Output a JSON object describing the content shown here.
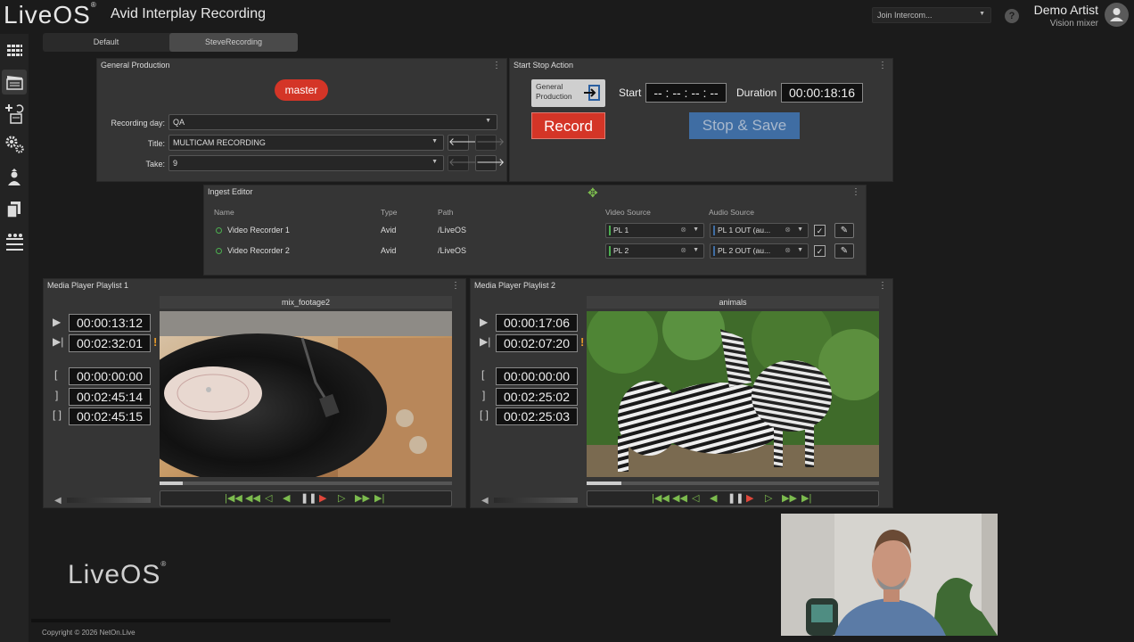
{
  "app": {
    "logo": "LiveOS",
    "title": "Avid Interplay Recording",
    "intercom_placeholder": "Join Intercom...",
    "help": "?",
    "user_name": "Demo Artist",
    "user_role": "Vision mixer"
  },
  "sidebar": [
    {
      "icon": "grid-icon"
    },
    {
      "icon": "clapper-icon"
    },
    {
      "icon": "add-clip-icon"
    },
    {
      "icon": "settings-gears-icon"
    },
    {
      "icon": "user-upload-icon"
    },
    {
      "icon": "copy-icon"
    },
    {
      "icon": "mixer-icon"
    }
  ],
  "tabs": [
    {
      "label": "Default",
      "active": false
    },
    {
      "label": "SteveRecording",
      "active": true
    }
  ],
  "general_production": {
    "title": "General Production",
    "badge": "master",
    "recording_day_label": "Recording day:",
    "recording_day_value": "QA",
    "title_label": "Title:",
    "title_value": "MULTICAM RECORDING",
    "take_label": "Take:",
    "take_value": "9"
  },
  "start_stop": {
    "title": "Start Stop Action",
    "source_label": "General Production",
    "start_label": "Start",
    "start_value": "-- : -- : -- : --",
    "duration_label": "Duration",
    "duration_value": "00:00:18:16",
    "record_label": "Record",
    "stop_label": "Stop & Save"
  },
  "ingest_editor": {
    "title": "Ingest Editor",
    "columns": [
      "Name",
      "Type",
      "Path",
      "Video Source",
      "Audio Source"
    ],
    "rows": [
      {
        "name": "Video Recorder 1",
        "type": "Avid",
        "path": "/LiveOS",
        "video": "PL 1",
        "audio": "PL 1 OUT (au..."
      },
      {
        "name": "Video Recorder 2",
        "type": "Avid",
        "path": "/LiveOS",
        "video": "PL 2",
        "audio": "PL 2 OUT (au..."
      }
    ]
  },
  "players": [
    {
      "title": "Media Player Playlist 1",
      "clip": "mix_footage2",
      "position": "00:00:13:12",
      "remaining": "00:02:32:01",
      "in": "00:00:00:00",
      "out": "00:02:45:14",
      "duration": "00:02:45:15",
      "progress": 0.08
    },
    {
      "title": "Media Player Playlist 2",
      "clip": "animals",
      "position": "00:00:17:06",
      "remaining": "00:02:07:20",
      "in": "00:00:00:00",
      "out": "00:02:25:02",
      "duration": "00:02:25:03",
      "progress": 0.12
    }
  ],
  "footer": {
    "logo": "LiveOS",
    "copyright": "Copyright © 2026 NetOn.Live"
  },
  "colors": {
    "record": "#d43527",
    "stop": "#3f6da3",
    "accent_green": "#7cbb4e"
  }
}
